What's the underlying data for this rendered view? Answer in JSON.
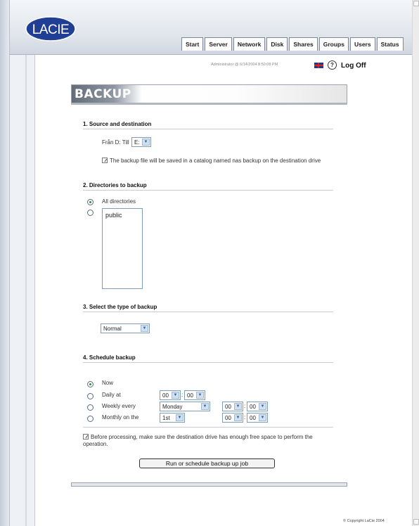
{
  "brand": {
    "logo_text": "LACIE",
    "accent": "#1f3e94"
  },
  "tabs": [
    "Start",
    "Server",
    "Network",
    "Disk",
    "Shares",
    "Groups",
    "Users",
    "Status"
  ],
  "topbar": {
    "info": "Administrator @ 6/14/2004 8:50:08 PM",
    "log_off": "Log Off",
    "help_glyph": "?"
  },
  "page_title": "BACKUP",
  "section1": {
    "title": "1. Source and destination",
    "from_label": "Från D: Till",
    "dest_value": "E:",
    "note": "The backup file will be saved in a catalog named nas backup on the destination drive"
  },
  "section2": {
    "title": "2. Directories to backup",
    "all_label": "All directories",
    "all_selected": true,
    "list_items": [
      "public"
    ]
  },
  "section3": {
    "title": "3. Select the type of backup",
    "type_value": "Normal"
  },
  "section4": {
    "title": "4. Schedule backup",
    "now": "Now",
    "daily": {
      "label": "Daily at",
      "hour": "00",
      "minute": "00"
    },
    "weekly": {
      "label": "Weekly every",
      "day": "Monday",
      "hour": "00",
      "minute": "00"
    },
    "monthly": {
      "label": "Monthly on the",
      "day": "1st",
      "hour": "00",
      "minute": "00"
    },
    "selected": "now",
    "separator": ":",
    "note": "Before processing, make sure the destination drive has enough free space to perform the operation."
  },
  "run_button": "Run or schedule backup up job",
  "footer": {
    "copyright": "© Copyright LaCie 2004"
  }
}
